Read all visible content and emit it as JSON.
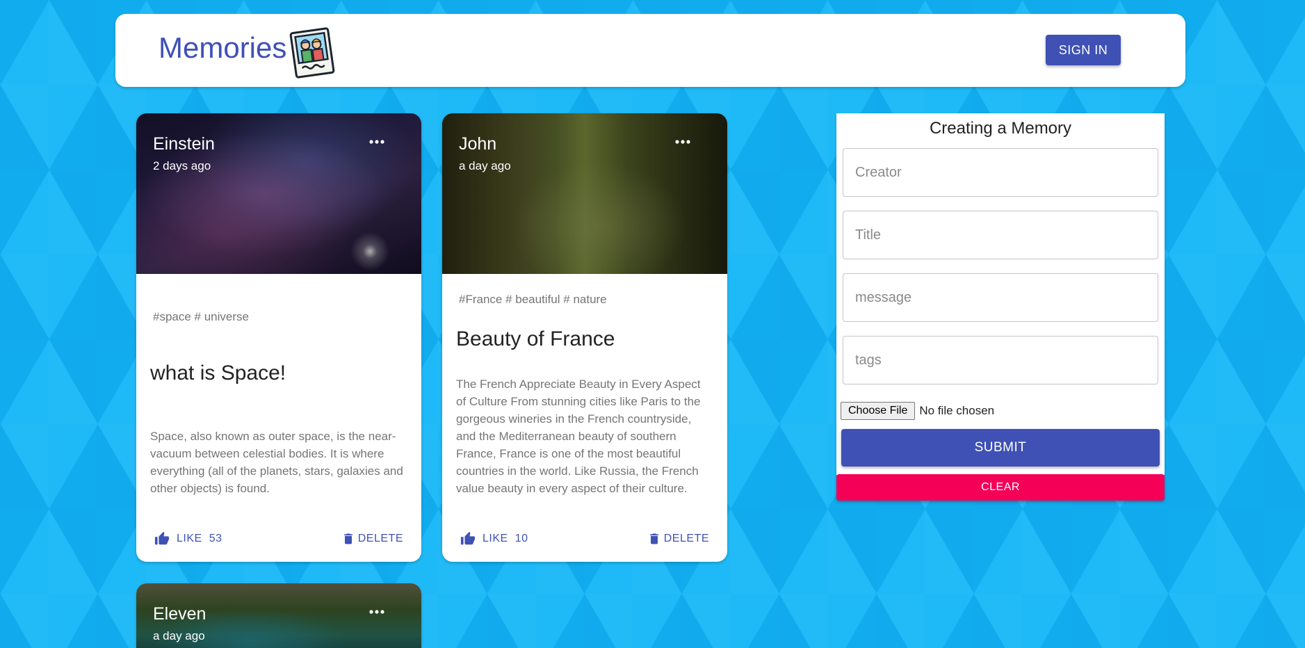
{
  "header": {
    "title": "Memories",
    "sign_in_label": "SIGN IN"
  },
  "posts": [
    {
      "creator": "Einstein",
      "time": "2 days ago",
      "tags": "#space # universe",
      "title": "what is Space!",
      "message": "Space, also known as outer space, is the near-vacuum between celestial bodies. It is where everything (all of the planets, stars, galaxies and other objects) is found.",
      "like_label": "LIKE",
      "like_count": "53",
      "delete_label": "DELETE"
    },
    {
      "creator": "John",
      "time": "a day ago",
      "tags": "#France # beautiful # nature",
      "title": "Beauty of France",
      "message": "The French Appreciate Beauty in Every Aspect of Culture From stunning cities like Paris to the gorgeous wineries in the French countryside, and the Mediterranean beauty of southern France, France is one of the most beautiful countries in the world. Like Russia, the French value beauty in every aspect of their culture.",
      "like_label": "LIKE",
      "like_count": "10",
      "delete_label": "DELETE"
    },
    {
      "creator": "Eleven",
      "time": "a day ago"
    }
  ],
  "form": {
    "title": "Creating a Memory",
    "creator_placeholder": "Creator",
    "title_placeholder": "Title",
    "message_placeholder": "message",
    "tags_placeholder": "tags",
    "choose_file_label": "Choose File",
    "file_status": "No file chosen",
    "submit_label": "SUBMIT",
    "clear_label": "CLEAR"
  },
  "colors": {
    "primary": "#3f51b5",
    "secondary": "#f50057",
    "background": "#14b4f5"
  },
  "icons": {
    "logo": "memories-photo-icon",
    "more": "more-horiz-icon",
    "like": "thumb-up-icon",
    "delete": "delete-icon"
  }
}
